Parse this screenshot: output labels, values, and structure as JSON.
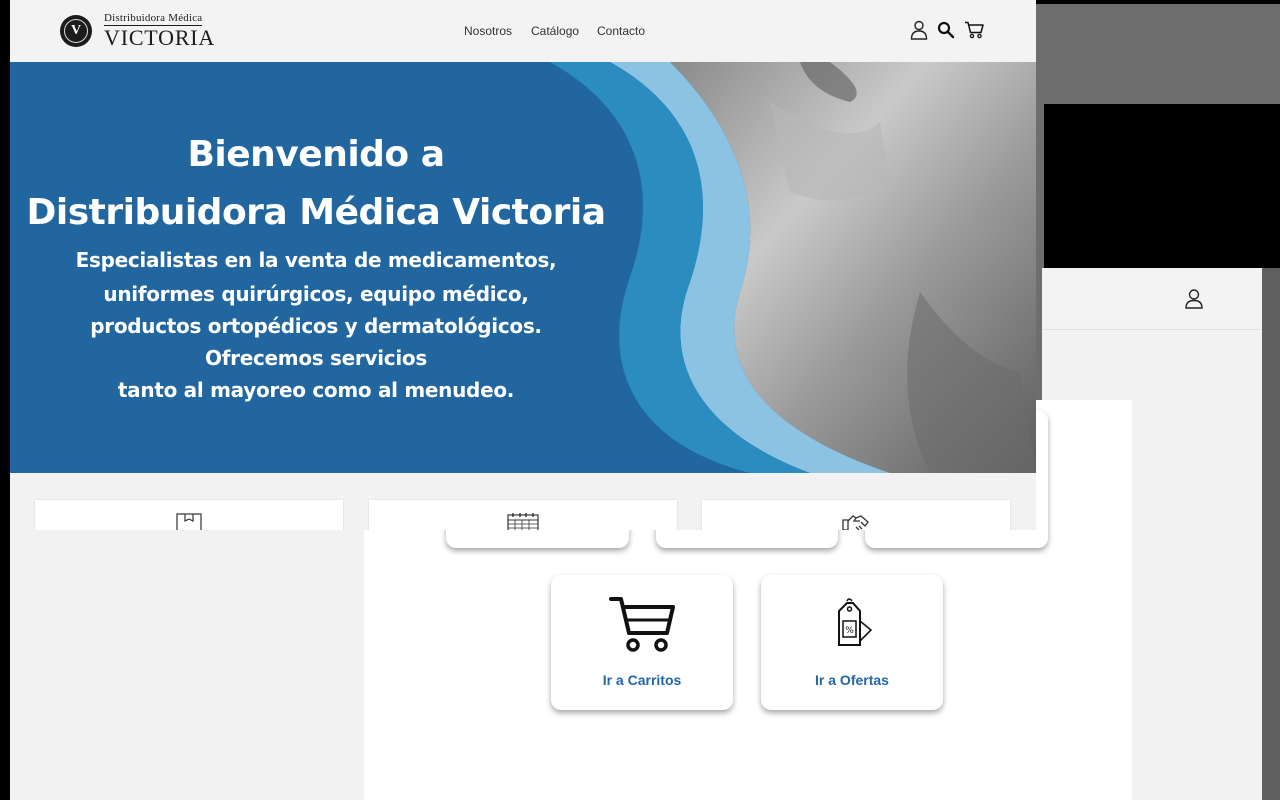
{
  "brand": {
    "logo_top": "Distribuidora Médica",
    "logo_main": "VICTORIA",
    "seal_letter": "V"
  },
  "nav": {
    "items": [
      "Nosotros",
      "Catálogo",
      "Contacto"
    ]
  },
  "header_icons": [
    "user-icon",
    "search-icon",
    "cart-icon"
  ],
  "hero": {
    "title_line1": "Bienvenido a",
    "title_line2": "Distribuidora Médica Victoria",
    "sub_lines": [
      "Especialistas en la venta de medicamentos,",
      "uniformes quirúrgicos, equipo médico,",
      "productos ortopédicos y dermatológicos.",
      "Ofrecemos servicios",
      "tanto al mayoreo como al menudeo."
    ]
  },
  "feature_icons": [
    "box-icon",
    "calendar-icon",
    "handshake-icon"
  ],
  "actions": [
    {
      "label": "Ir a Carritos",
      "icon": "cart-icon"
    },
    {
      "label": "Ir a Ofertas",
      "icon": "price-tag-icon"
    }
  ],
  "colors": {
    "hero_blue": "#2266a0",
    "wave_mid": "#2b8cbf",
    "wave_light": "#8cc3e3",
    "link_blue": "#2366a8",
    "header_bg": "#f3f3f3"
  }
}
